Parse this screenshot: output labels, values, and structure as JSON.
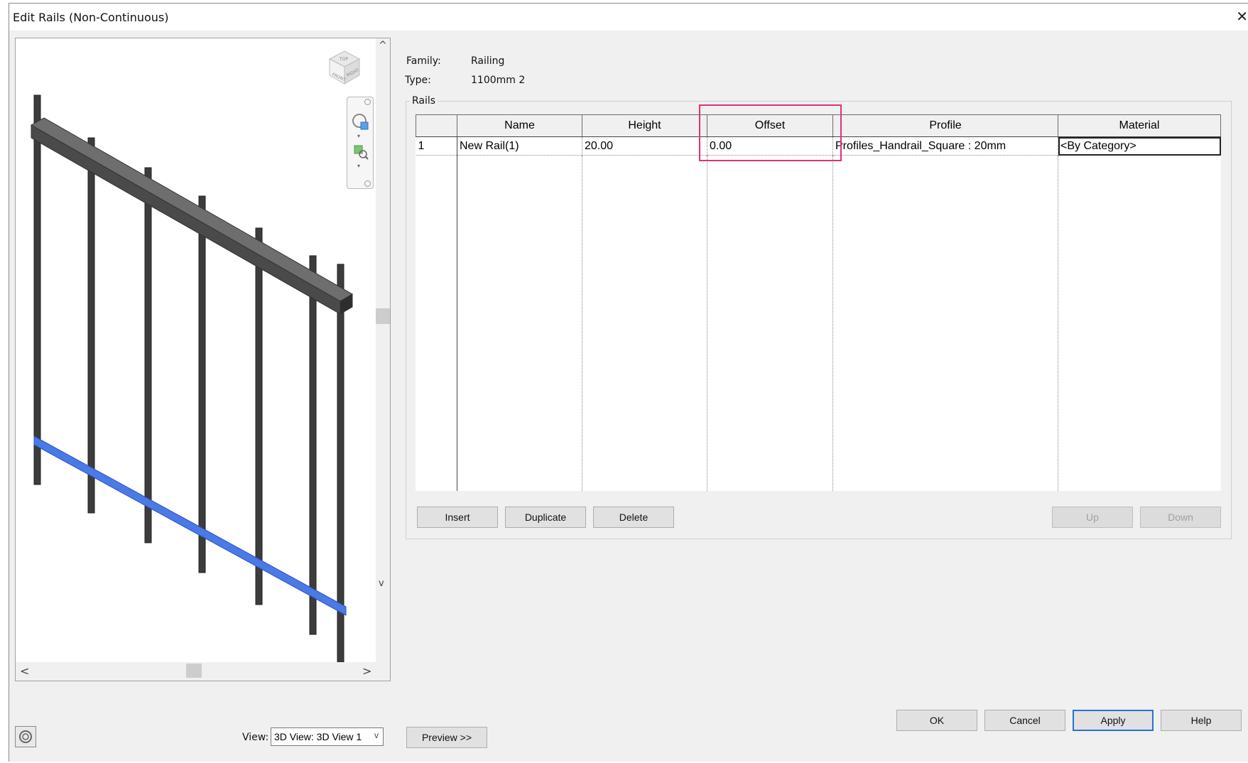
{
  "window": {
    "title": "Edit Rails (Non-Continuous)",
    "close_glyph": "✕"
  },
  "info": {
    "family_label": "Family:",
    "family_value": "Railing",
    "type_label": "Type:",
    "type_value": "1100mm 2"
  },
  "rails": {
    "group_label": "Rails",
    "columns": [
      "Name",
      "Height",
      "Offset",
      "Profile",
      "Material"
    ],
    "rows": [
      {
        "num": "1",
        "name": "New Rail(1)",
        "height": "20.00",
        "offset": "0.00",
        "profile": "Profiles_Handrail_Square : 20mm",
        "material": "<By Category>"
      }
    ]
  },
  "buttons": {
    "insert": "Insert",
    "duplicate": "Duplicate",
    "delete": "Delete",
    "up": "Up",
    "down": "Down",
    "ok": "OK",
    "cancel": "Cancel",
    "apply": "Apply",
    "help": "Help",
    "preview": "Preview >>"
  },
  "view": {
    "label": "View:",
    "selected": "3D View: 3D View 1"
  },
  "viewcube": {
    "faces": [
      "FRONT",
      "RIGHT",
      "TOP"
    ]
  },
  "icons": {
    "up_arrow": "^",
    "down_arrow": "v",
    "left_arrow": "<",
    "right_arrow": ">",
    "dropdown": "v"
  },
  "colors": {
    "highlight": "#e0307a",
    "rail_blue": "#4b79e6",
    "default_button_border": "#2a6fd6"
  }
}
